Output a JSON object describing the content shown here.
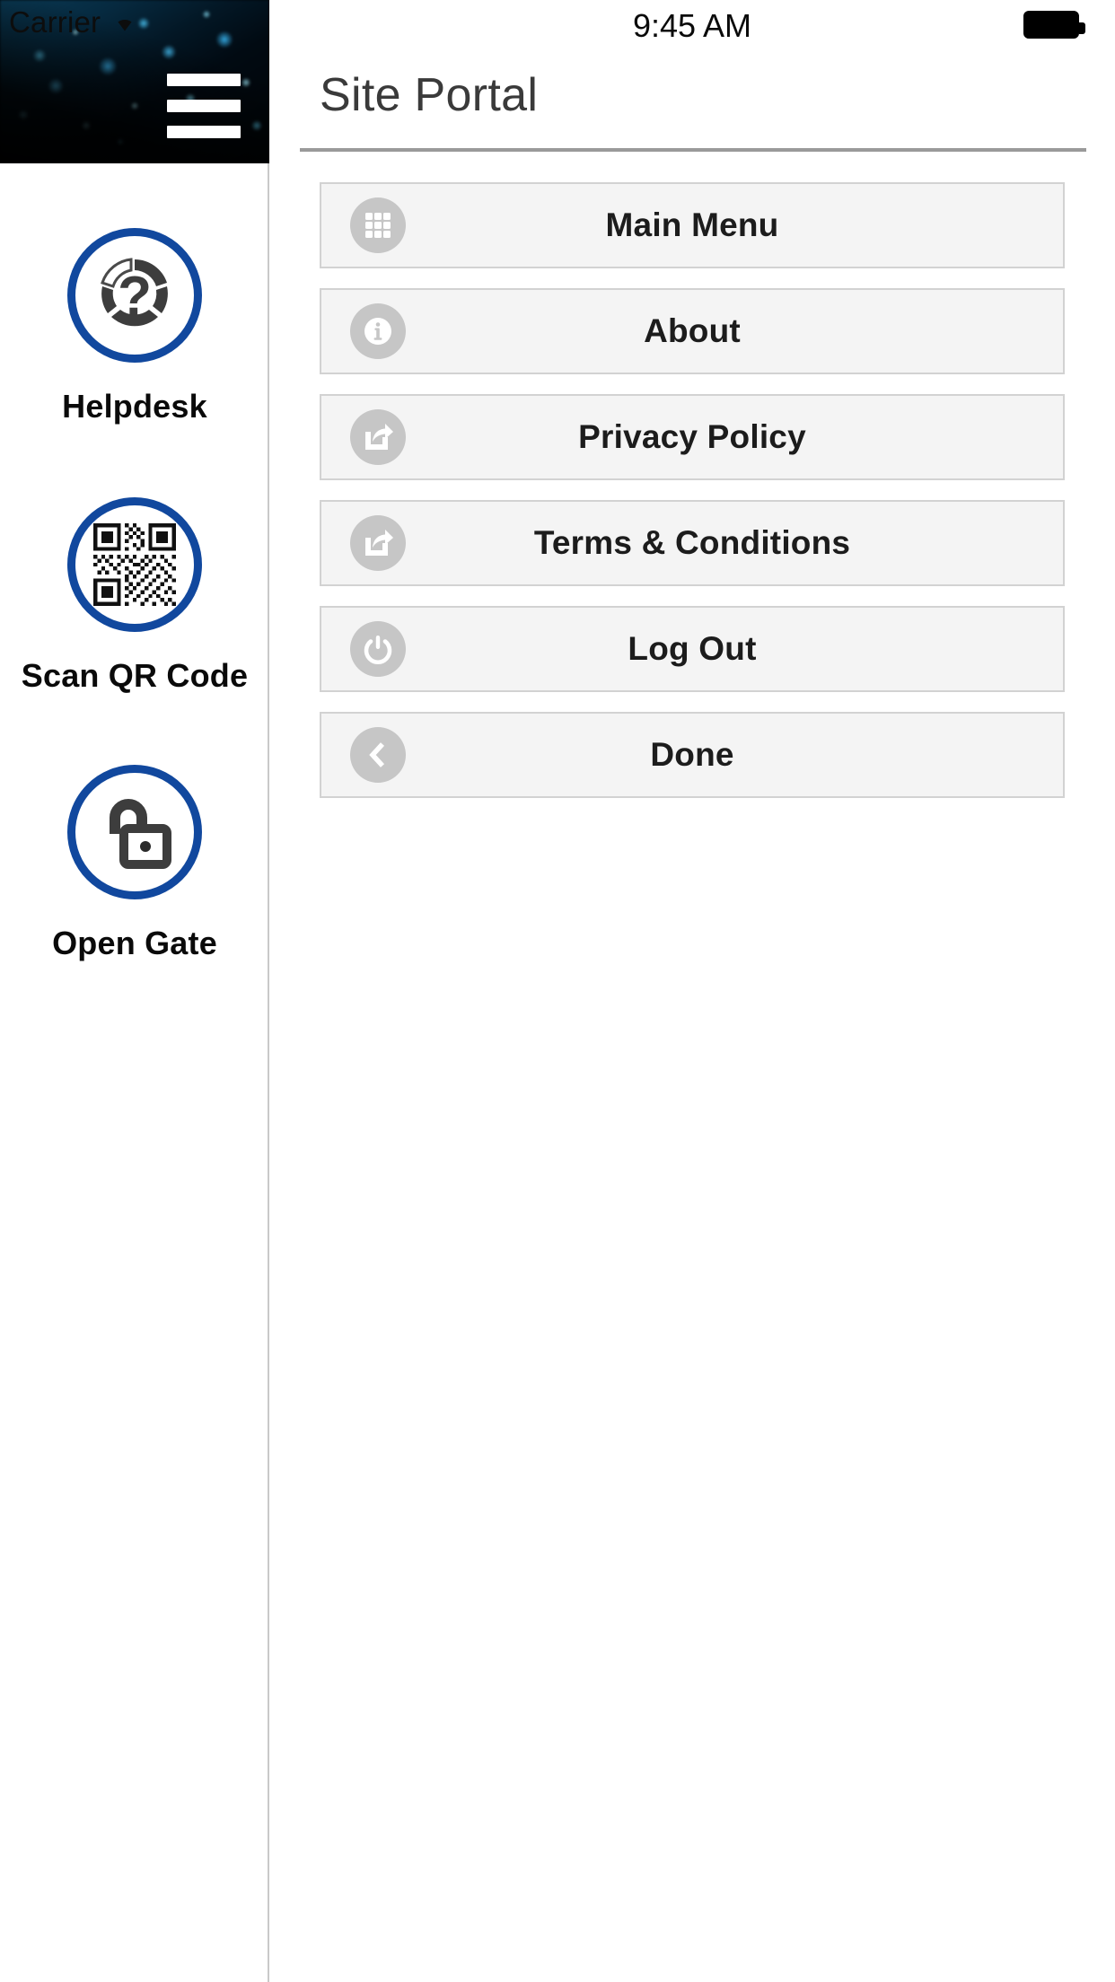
{
  "statusbar": {
    "carrier": "Carrier",
    "wifi_icon": "wifi-icon",
    "time": "9:45 AM",
    "battery_icon": "battery-full-icon"
  },
  "drawer": {
    "menu_button_icon": "hamburger-menu-icon",
    "header_image": "blue-bokeh-particles-banner",
    "items": [
      {
        "label": "Helpdesk",
        "icon": "question-mark-help-icon"
      },
      {
        "label": "Scan QR Code",
        "icon": "qr-code-icon"
      },
      {
        "label": "Open Gate",
        "icon": "open-padlock-icon"
      }
    ]
  },
  "main": {
    "title": "Site Portal",
    "menu": [
      {
        "label": "Main Menu",
        "icon": "grid-apps-icon"
      },
      {
        "label": "About",
        "icon": "info-circle-icon"
      },
      {
        "label": "Privacy Policy",
        "icon": "external-link-share-icon"
      },
      {
        "label": "Terms & Conditions",
        "icon": "external-link-share-icon"
      },
      {
        "label": "Log Out",
        "icon": "power-icon"
      },
      {
        "label": "Done",
        "icon": "chevron-left-icon"
      }
    ]
  },
  "colors": {
    "brand_blue": "#11489e",
    "row_background": "#f4f4f4",
    "row_border": "#d2d2d2",
    "icon_circle": "#c6c6c6",
    "title_text": "#3a3a3a"
  }
}
